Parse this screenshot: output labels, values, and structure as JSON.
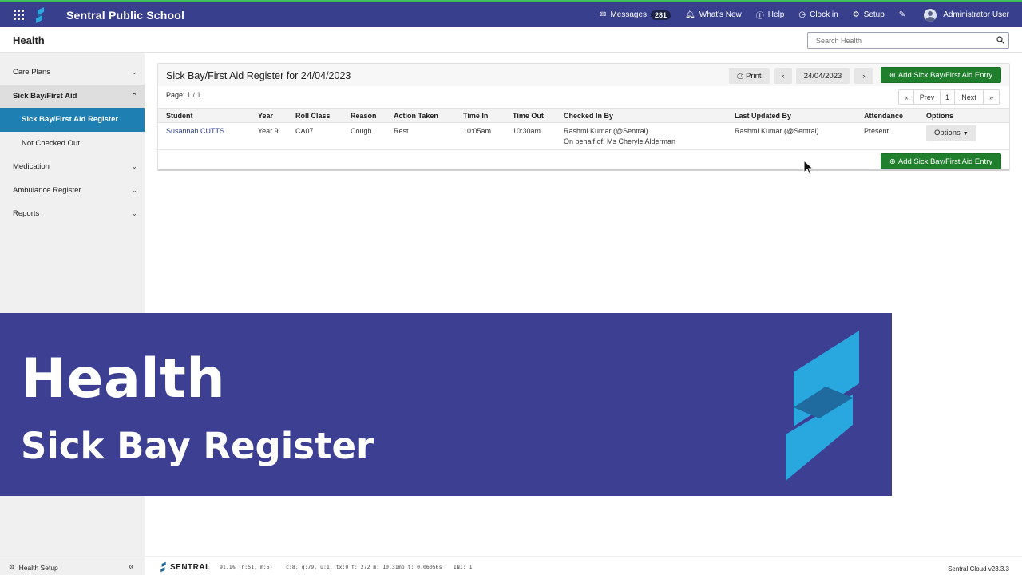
{
  "topbar": {
    "school_name": "Sentral Public School",
    "messages_label": "Messages",
    "messages_count": "281",
    "whats_new": "What's New",
    "help": "Help",
    "clock_in": "Clock in",
    "setup": "Setup",
    "user": "Administrator User",
    "accent_color": "#383f8c",
    "stripe_color": "#3ec15d"
  },
  "subheader": {
    "title": "Health",
    "search_placeholder": "Search Health"
  },
  "sidebar": {
    "items": [
      {
        "label": "Care Plans",
        "icon": "chevron-down-icon"
      },
      {
        "label": "Sick Bay/First Aid",
        "icon": "chevron-up-icon"
      },
      {
        "label": "Sick Bay/First Aid Register"
      },
      {
        "label": "Not Checked Out"
      },
      {
        "label": "Medication",
        "icon": "chevron-down-icon"
      },
      {
        "label": "Ambulance Register",
        "icon": "chevron-down-icon"
      },
      {
        "label": "Reports",
        "icon": "chevron-down-icon"
      }
    ],
    "selected_color": "#1d7fb2"
  },
  "panel": {
    "title": "Sick Bay/First Aid Register for 24/04/2023",
    "print_label": "Print",
    "date": "24/04/2023",
    "add_label": "Add Sick Bay/First Aid Entry",
    "page_label": "Page:",
    "page_value": "1 / 1",
    "pager": {
      "first": "«",
      "prev": "Prev",
      "current": "1",
      "next": "Next",
      "last": "»"
    },
    "add_color": "#1f7f2c"
  },
  "table": {
    "headers": [
      "Student",
      "Year",
      "Roll Class",
      "Reason",
      "Action Taken",
      "Time In",
      "Time Out",
      "Checked In By",
      "Last Updated By",
      "Attendance",
      "Options"
    ],
    "rows": [
      {
        "student": "Susannah CUTTS",
        "year": "Year 9",
        "roll_class": "CA07",
        "reason": "Cough",
        "action": "Rest",
        "time_in": "10:05am",
        "time_out": "10:30am",
        "checked_in_by": "Rashmi Kumar (@Sentral)",
        "checked_in_behalf": "On behalf of: Ms Cheryle Alderman",
        "last_updated_by": "Rashmi Kumar (@Sentral)",
        "attendance": "Present",
        "options_label": "Options"
      }
    ]
  },
  "banner": {
    "title": "Health",
    "subtitle": "Sick Bay Register",
    "bg_color": "#3d3f93"
  },
  "footer": {
    "health_setup": "Health Setup",
    "brand": "SENTRAL",
    "debug1": "91.1% (n:51, m:5)",
    "debug2": "c:8, q:79, u:1, tx:0",
    "debug3": "f: 272 m: 10.31mb t: 0.06056s",
    "debug4": "INI: 1",
    "version": "Sentral Cloud v23.3.3"
  }
}
